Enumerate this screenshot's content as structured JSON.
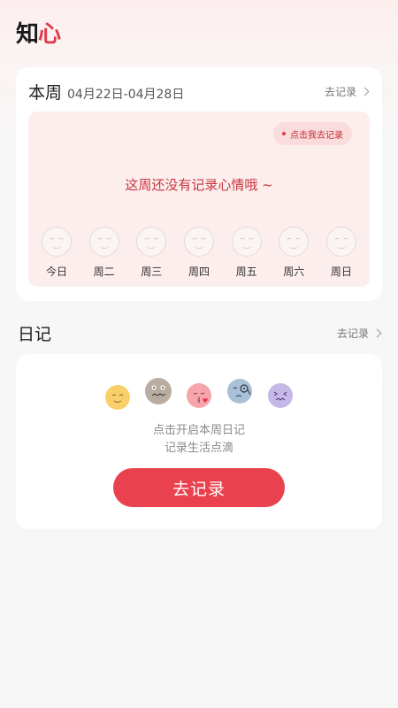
{
  "app": {
    "logo_main": "知",
    "logo_accent": "心"
  },
  "week": {
    "title": "本周",
    "range": "04月22日-04月28日",
    "link": "去记录",
    "bubble": "点击我去记录",
    "empty_message": "这周还没有记录心情哦 ~",
    "days": [
      "今日",
      "周二",
      "周三",
      "周四",
      "周五",
      "周六",
      "周日"
    ]
  },
  "diary": {
    "title": "日记",
    "link": "去记录",
    "hint_line1": "点击开启本周日记",
    "hint_line2": "记录生活点滴",
    "cta": "去记录",
    "emoji_icons": [
      "smile-yellow-icon",
      "worried-gray-icon",
      "kiss-pink-icon",
      "monocle-blue-icon",
      "squint-purple-icon"
    ]
  },
  "colors": {
    "accent": "#e9424e",
    "panel": "#fdeeee"
  }
}
